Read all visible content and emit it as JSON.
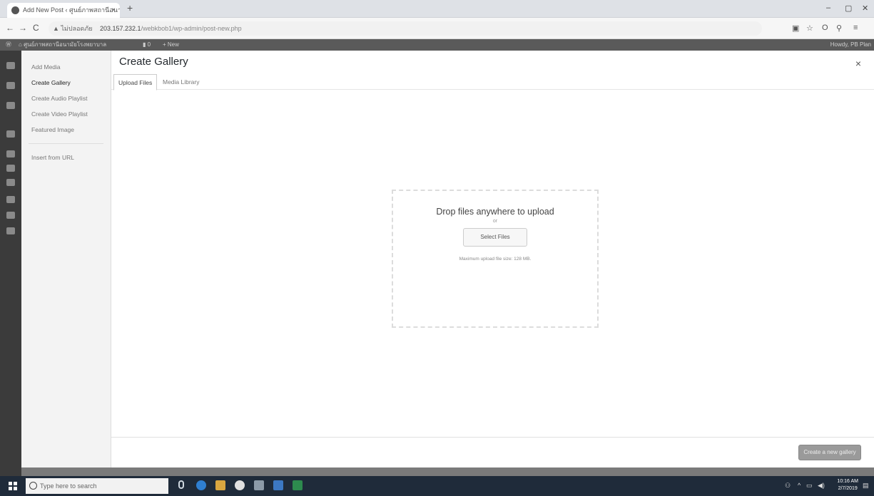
{
  "browser": {
    "tab_title": "Add New Post ‹ ศูนย์ภาพสถานีอนามัยฯ —",
    "tab_close": "×",
    "new_tab": "+",
    "address_warning": "▲ ไม่ปลอดภัย",
    "url_host": "203.157.232.1",
    "url_path": "/webkbob1/wp-admin/post-new.php",
    "nav_back": "←",
    "nav_forward": "→",
    "nav_reload": "C",
    "win_min": "–",
    "win_max": "▢",
    "win_close": "✕"
  },
  "adminbar": {
    "site_name": "ศูนย์ภาพสถานีอนามัยโรงพยาบาล",
    "comments": "0",
    "new_label": "+ New",
    "howdy": "Howdy, PB Plan"
  },
  "media_modal": {
    "menu": [
      {
        "label": "Add Media"
      },
      {
        "label": "Create Gallery"
      },
      {
        "label": "Create Audio Playlist"
      },
      {
        "label": "Create Video Playlist"
      },
      {
        "label": "Featured Image"
      },
      {
        "label": "Insert from URL"
      }
    ],
    "title": "Create Gallery",
    "close": "×",
    "tabs": [
      {
        "label": "Upload Files"
      },
      {
        "label": "Media Library"
      }
    ],
    "uploader": {
      "heading": "Drop files anywhere to upload",
      "or": "or",
      "select_button": "Select Files",
      "max_size": "Maximum upload file size: 128 MB."
    },
    "create_button": "Create a new gallery"
  },
  "taskbar": {
    "search_placeholder": "Type here to search",
    "time": "10:16 AM",
    "date": "2/7/2019"
  }
}
